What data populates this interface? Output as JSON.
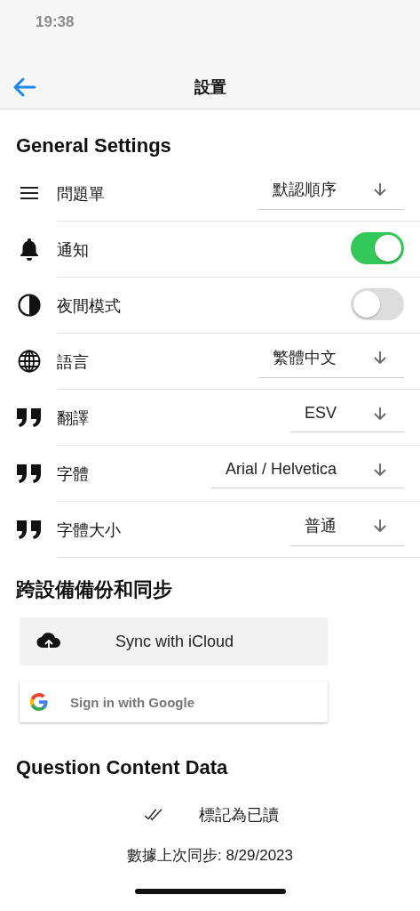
{
  "status_bar": {
    "time": "19:38"
  },
  "header": {
    "title": "設置"
  },
  "general": {
    "heading": "General Settings",
    "rows": [
      {
        "kind": "select",
        "label": "問題單",
        "value": "默認順序"
      },
      {
        "kind": "toggle",
        "label": "通知",
        "on": true
      },
      {
        "kind": "toggle",
        "label": "夜間模式",
        "on": false
      },
      {
        "kind": "select",
        "label": "語言",
        "value": "繁體中文"
      },
      {
        "kind": "select",
        "label": "翻譯",
        "value": "ESV"
      },
      {
        "kind": "select",
        "label": "字體",
        "value": "Arial / Helvetica"
      },
      {
        "kind": "select",
        "label": "字體大小",
        "value": "普通"
      }
    ]
  },
  "sync": {
    "heading": "跨設備備份和同步",
    "icloud_button": "Sync with iCloud",
    "google_button": "Sign in with Google"
  },
  "content_data": {
    "heading": "Question Content Data",
    "mark_read": "標記為已讀",
    "last_sync": "數據上次同步: 8/29/2023"
  }
}
